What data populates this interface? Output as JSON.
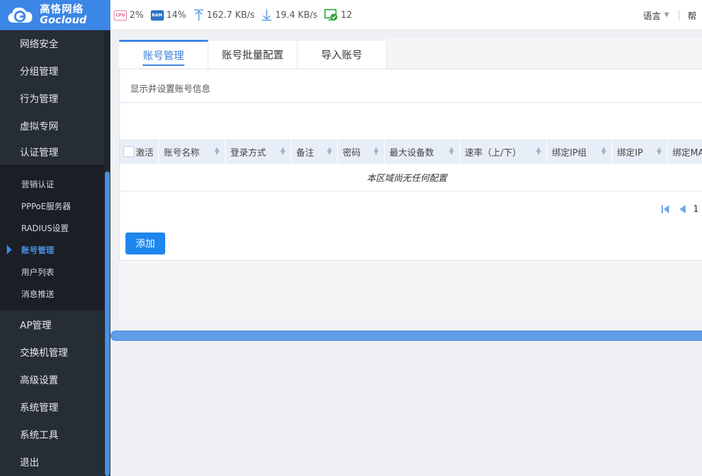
{
  "brand": {
    "name_cn": "高恪网络",
    "name_en": "Gocloud"
  },
  "stats": {
    "cpu_label": "CPU",
    "cpu": "2%",
    "ram_label": "RAM",
    "ram": "14%",
    "upload": "162.7 KB/s",
    "download": "19.4 KB/s",
    "devices": "12"
  },
  "header": {
    "language": "语言",
    "help": "帮"
  },
  "sidebar": {
    "items": [
      {
        "label": "网络安全"
      },
      {
        "label": "分组管理"
      },
      {
        "label": "行为管理"
      },
      {
        "label": "虚拟专网"
      },
      {
        "label": "认证管理"
      },
      {
        "label": "AP管理"
      },
      {
        "label": "交换机管理"
      },
      {
        "label": "高级设置"
      },
      {
        "label": "系统管理"
      },
      {
        "label": "系统工具"
      },
      {
        "label": "退出"
      }
    ],
    "sub_items": [
      {
        "label": "营销认证"
      },
      {
        "label": "PPPoE服务器"
      },
      {
        "label": "RADIUS设置"
      },
      {
        "label": "账号管理"
      },
      {
        "label": "用户列表"
      },
      {
        "label": "消息推送"
      }
    ]
  },
  "tabs": [
    {
      "label": "账号管理"
    },
    {
      "label": "账号批量配置"
    },
    {
      "label": "导入账号"
    }
  ],
  "panel": {
    "description": "显示并设置账号信息",
    "columns": [
      "激活",
      "账号名称",
      "登录方式",
      "备注",
      "密码",
      "最大设备数",
      "速率（上/下）",
      "绑定IP组",
      "绑定IP",
      "绑定MA"
    ],
    "empty_text": "本区域尚无任何配置",
    "page": "1",
    "add_label": "添加"
  },
  "colors": {
    "accent": "#3b86e6",
    "sidebar_bg": "#262d36",
    "button": "#1f86ee"
  }
}
